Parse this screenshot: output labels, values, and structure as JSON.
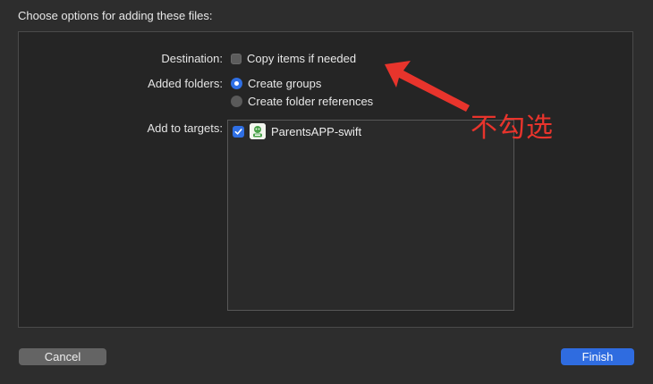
{
  "dialog": {
    "title": "Choose options for adding these files:"
  },
  "destination": {
    "label": "Destination:",
    "option_label": "Copy items if needed",
    "checked": false
  },
  "added_folders": {
    "label": "Added folders:",
    "options": [
      {
        "label": "Create groups",
        "selected": true
      },
      {
        "label": "Create folder references",
        "selected": false
      }
    ]
  },
  "targets": {
    "label": "Add to targets:",
    "items": [
      {
        "label": "ParentsAPP-swift",
        "checked": true,
        "icon": "app-icon"
      }
    ]
  },
  "annotation": {
    "text": "不勾选",
    "color": "#e8342c"
  },
  "buttons": {
    "cancel_label": "Cancel",
    "finish_label": "Finish"
  },
  "colors": {
    "accent": "#2f6ce0"
  }
}
